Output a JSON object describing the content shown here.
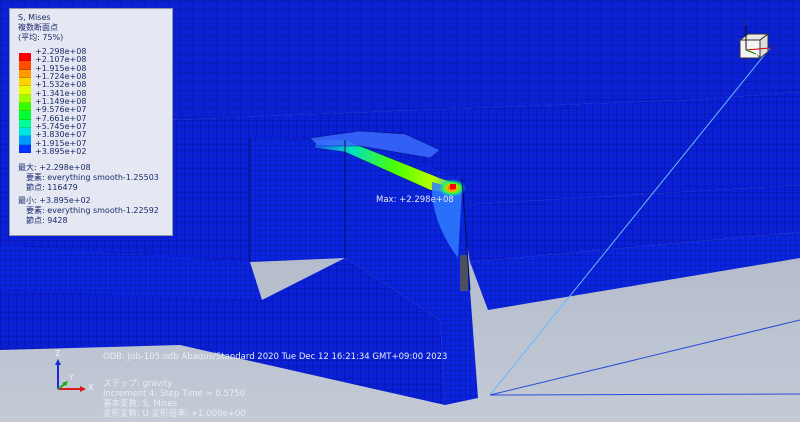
{
  "legend": {
    "title": "S, Mises",
    "subtitle": "複数断面点",
    "average": "(平均: 75%)",
    "entries": [
      {
        "label": "+2.298e+08",
        "color": "#ff0000"
      },
      {
        "label": "+2.107e+08",
        "color": "#ff4d00"
      },
      {
        "label": "+1.915e+08",
        "color": "#ff9a00"
      },
      {
        "label": "+1.724e+08",
        "color": "#ffd500"
      },
      {
        "label": "+1.532e+08",
        "color": "#e6ff00"
      },
      {
        "label": "+1.341e+08",
        "color": "#99ff00"
      },
      {
        "label": "+1.149e+08",
        "color": "#33ff00"
      },
      {
        "label": "+9.576e+07",
        "color": "#00ff33"
      },
      {
        "label": "+7.661e+07",
        "color": "#00ff99"
      },
      {
        "label": "+5.745e+07",
        "color": "#00e6e6"
      },
      {
        "label": "+3.830e+07",
        "color": "#0099ff"
      },
      {
        "label": "+1.915e+07",
        "color": "#0033ff"
      },
      {
        "label": "+3.895e+02",
        "color": ""
      }
    ],
    "max_value": "最大: +2.298e+08",
    "max_element": "要素: everything smooth-1.25503",
    "max_node": "節点: 116479",
    "min_value": "最小: +3.895e+02",
    "min_element": "要素: everything smooth-1.22592",
    "min_node": "節点: 9428"
  },
  "viewport": {
    "max_label": "Max: +2.298e+08"
  },
  "info": {
    "odb": "ODB: Job-105.odb    Abaqus/Standard 2020    Tue Dec 12 16:21:34 GMT+09:00 2023",
    "step": "ステップ: gravity",
    "increment": "Increment      4: Step Time =    0.5750",
    "primary_var": "基本変数: S, Mises",
    "deformed_var": "変形変数: U   変形倍率: +1.000e+00"
  },
  "triad": {
    "x": "X",
    "y": "Y",
    "z": "Z"
  },
  "colors": {
    "mesh_blue": "#0a1fd6",
    "mesh_line": "#00126e",
    "background_top": "#9aa6bd",
    "background_bottom": "#c4cad6",
    "hotspot_red": "#ff0000",
    "hotspot_yellow": "#ffd500",
    "hotspot_green": "#33ff00"
  }
}
